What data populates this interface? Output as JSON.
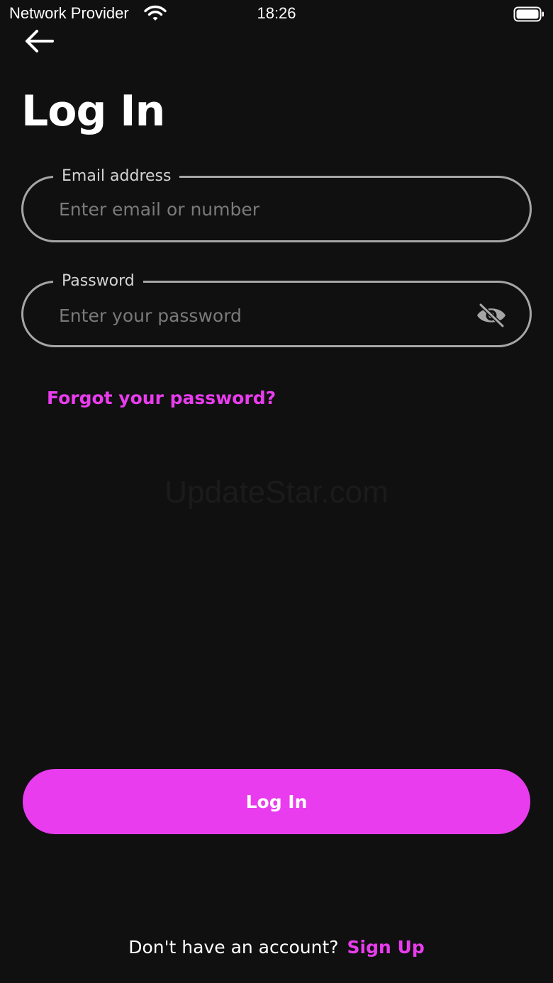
{
  "status_bar": {
    "carrier": "Network Provider",
    "time": "18:26",
    "wifi_icon": "wifi-icon",
    "battery_icon": "battery-full-icon"
  },
  "header": {
    "back_icon": "arrow-left-icon",
    "title": "Log In"
  },
  "form": {
    "email": {
      "label": "Email address",
      "value": "",
      "placeholder": "Enter email or number"
    },
    "password": {
      "label": "Password",
      "value": "",
      "placeholder": "Enter your password",
      "toggle_icon": "eye-off-icon"
    },
    "forgot_label": "Forgot your password?"
  },
  "watermark": "UpdateStar.com",
  "actions": {
    "login_label": "Log In"
  },
  "footer": {
    "prompt": "Don't have an account?",
    "signup_label": "Sign Up"
  },
  "colors": {
    "background": "#101010",
    "accent": "#ea3cef",
    "field_border": "#a6a6a6",
    "placeholder": "#7a7a7a"
  }
}
